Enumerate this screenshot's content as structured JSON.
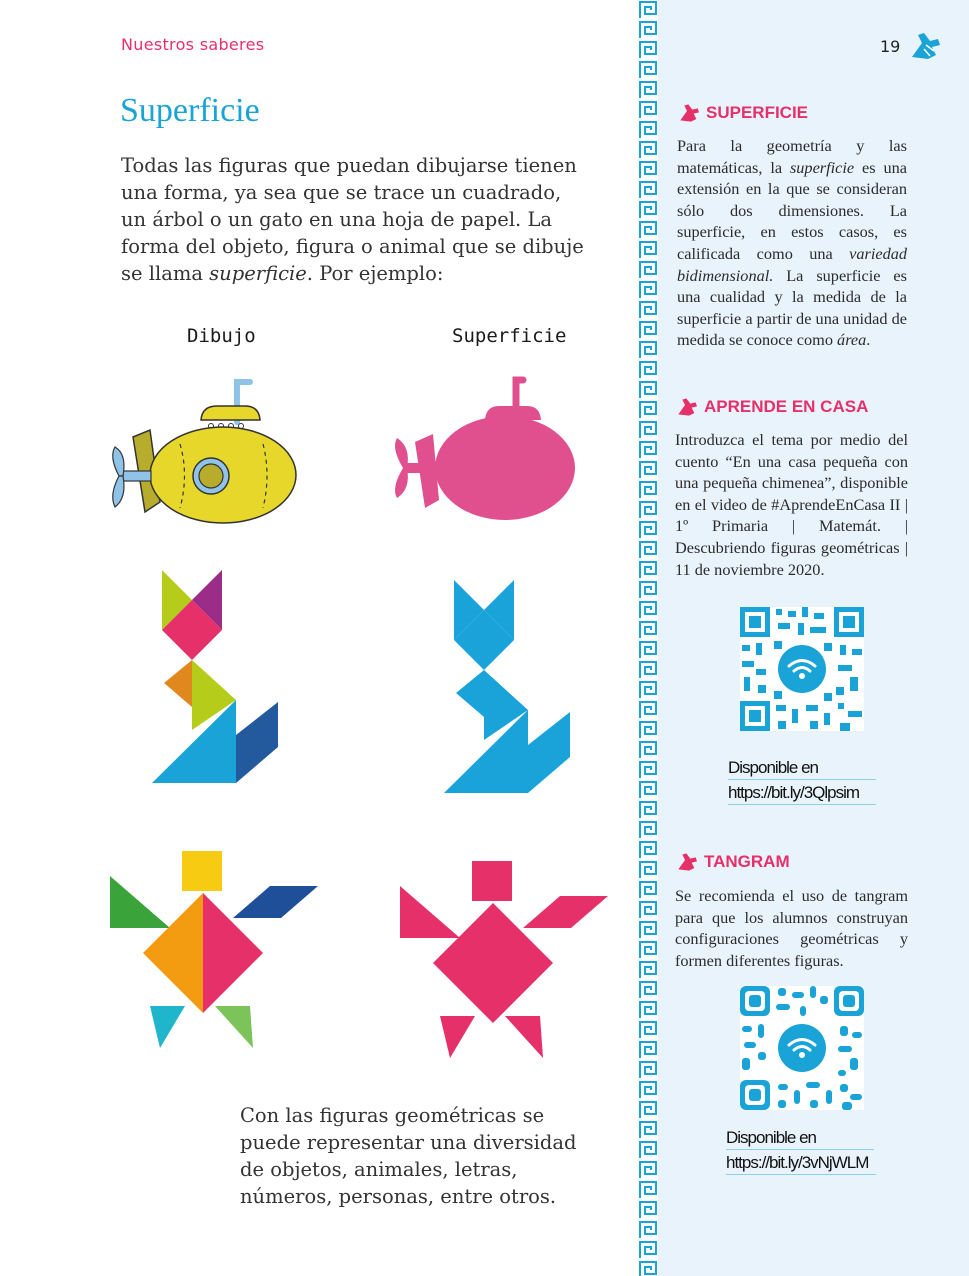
{
  "header": {
    "section_label": "Nuestros saberes",
    "page_number": "19"
  },
  "main": {
    "title": "Superficie",
    "intro_part1": "Todas las figuras que puedan dibujarse tienen una forma,  ya sea que se trace un cuadrado, un árbol o un gato en una hoja de papel. La forma del objeto, figura o animal que se dibuje se llama ",
    "intro_em": "superficie",
    "intro_part2": ". Por ejemplo:",
    "column_draw": "Dibujo",
    "column_surface": "Superficie",
    "outro": "Con las figuras geométricas se puede representar una diversidad de objetos, animales, letras, números, personas, entre otros."
  },
  "sidebar": {
    "superficie": {
      "heading": "SUPERFICIE",
      "t1": "Para la geometría y las matemáticas, la ",
      "e1": "superficie",
      "t2": " es una extensión en la que se consideran sólo dos dimensiones. La superficie, en estos casos, es calificada como una ",
      "e2": "variedad bidimensional.",
      "t3": " La superficie es una cualidad y la medida de la superficie a partir de una unidad de medida se conoce como ",
      "e3": "área",
      "t4": "."
    },
    "aprende": {
      "heading": "APRENDE EN CASA",
      "text": "Introduzca el tema por medio del cuento “En una casa pequeña con una pequeña chimenea”, disponible en el video de #AprendeEnCasa II | 1º Primaria | Matemát. | Descubriendo figuras geométricas | 11 de noviembre 2020.",
      "available": "Disponible en",
      "link": "https://bit.ly/3Qlpsim"
    },
    "tangram": {
      "heading": "TANGRAM",
      "text": "Se recomienda el uso de tangram para que los alumnos construyan configuraciones geométricas y formen diferentes figuras.",
      "available": "Disponible en",
      "link": "https://bit.ly/3vNjWLM"
    }
  },
  "colors": {
    "accent_pink": "#e6306a",
    "accent_blue": "#19a3d6",
    "sidebar_bg": "#e9f3fb",
    "submarine_yellow": "#e6d72a",
    "silhouette_pink": "#e0508f",
    "silhouette_blue": "#1aa3d9"
  },
  "icons": [
    "hand-icon",
    "qr-code-icon",
    "wifi-icon",
    "greek-key-border"
  ]
}
